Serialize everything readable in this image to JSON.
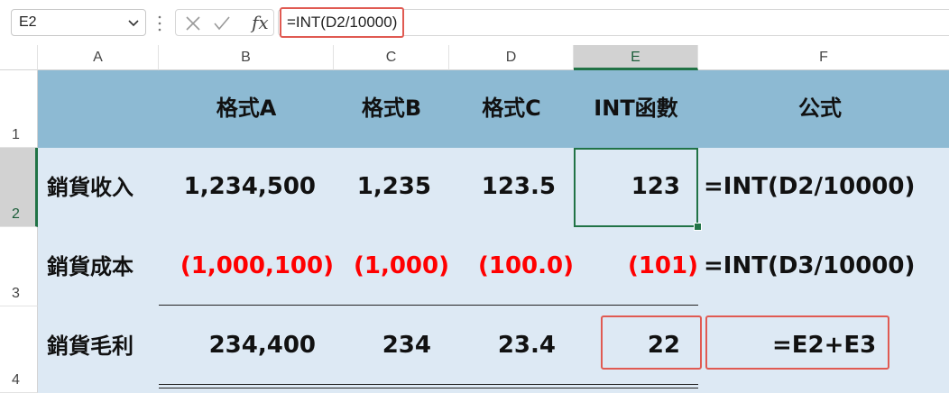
{
  "formula_bar": {
    "name_box": "E2",
    "formula": "=INT(D2/10000)",
    "fx_label": "fx"
  },
  "columns": [
    "A",
    "B",
    "C",
    "D",
    "E",
    "F"
  ],
  "rows": [
    "1",
    "2",
    "3",
    "4"
  ],
  "selected_cell": "E2",
  "table": {
    "header": [
      "",
      "格式A",
      "格式B",
      "格式C",
      "INT函數",
      "公式"
    ],
    "rows": [
      [
        "銷貨收入",
        "1,234,500",
        "1,235",
        "123.5",
        "123",
        "=INT(D2/10000)"
      ],
      [
        "銷貨成本",
        "(1,000,100)",
        "(1,000)",
        "(100.0)",
        "(101)",
        "=INT(D3/10000)"
      ],
      [
        "銷貨毛利",
        "234,400",
        "234",
        "23.4",
        "22",
        "=E2+E3"
      ]
    ]
  },
  "colors": {
    "header_fill": "#8dbad3",
    "body_fill": "#dde9f4",
    "negative_text": "#ff0000",
    "highlight_border": "#e05a52",
    "selection": "#217346"
  },
  "icons": [
    "chevron-down-icon",
    "more-options-icon",
    "cancel-icon",
    "enter-icon"
  ]
}
